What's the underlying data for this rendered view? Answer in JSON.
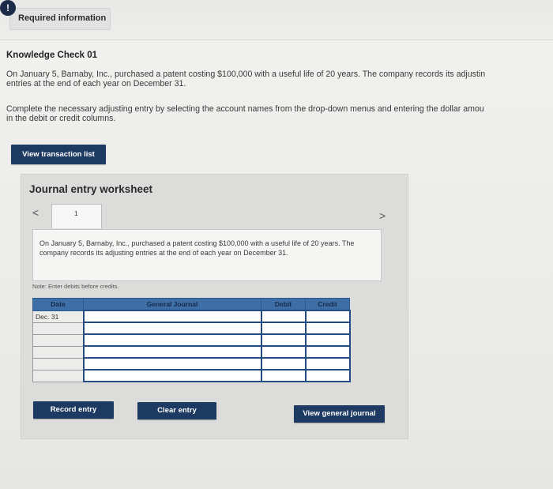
{
  "header": {
    "required_info_label": "Required information",
    "alert_glyph": "!"
  },
  "knowledge_check": {
    "title": "Knowledge Check 01",
    "paragraph1_line1": "On January 5, Barnaby, Inc., purchased a patent costing $100,000 with a useful life of 20 years. The company records its adjustin",
    "paragraph1_line2": "entries at the end of each year on December 31.",
    "paragraph2_line1": "Complete the necessary adjusting entry by selecting the account names from the drop-down menus and entering the dollar amou",
    "paragraph2_line2": "in the debit or credit columns."
  },
  "view_transaction_list_label": "View transaction list",
  "worksheet": {
    "title": "Journal entry worksheet",
    "prev_glyph": "<",
    "next_glyph": ">",
    "page_number": "1",
    "description": "On January 5, Barnaby, Inc., purchased a patent costing $100,000 with a useful life of 20 years. The company records its adjusting entries at the end of each year on December 31.",
    "note": "Note: Enter debits before credits.",
    "table": {
      "headers": {
        "date": "Date",
        "general_journal": "General Journal",
        "debit": "Debit",
        "credit": "Credit"
      },
      "rows": [
        {
          "date": "Dec. 31",
          "account": "",
          "debit": "",
          "credit": ""
        },
        {
          "date": "",
          "account": "",
          "debit": "",
          "credit": ""
        },
        {
          "date": "",
          "account": "",
          "debit": "",
          "credit": ""
        },
        {
          "date": "",
          "account": "",
          "debit": "",
          "credit": ""
        },
        {
          "date": "",
          "account": "",
          "debit": "",
          "credit": ""
        },
        {
          "date": "",
          "account": "",
          "debit": "",
          "credit": ""
        }
      ]
    },
    "record_entry_label": "Record entry",
    "clear_entry_label": "Clear entry",
    "view_general_journal_label": "View general journal"
  },
  "colors": {
    "button_navy": "#1d3a63",
    "table_header_blue": "#3d6fa6",
    "input_border_blue": "#244c82"
  }
}
